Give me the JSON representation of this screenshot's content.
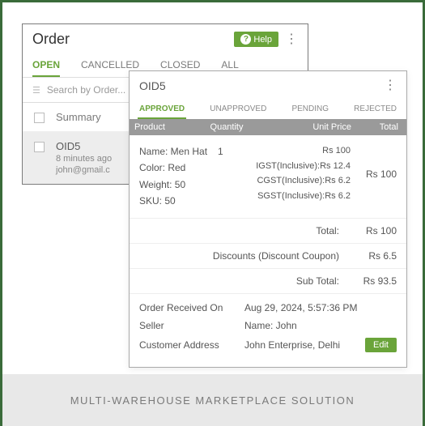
{
  "footer": "MULTI-WAREHOUSE MARKETPLACE SOLUTION",
  "panel1": {
    "title": "Order",
    "help": "Help",
    "tabs": [
      "OPEN",
      "CANCELLED",
      "CLOSED",
      "ALL"
    ],
    "search_placeholder": "Search by Order...",
    "summary_label": "Summary",
    "item": {
      "id": "OID5",
      "time": "8 minutes ago",
      "email": "john@gmail.c"
    }
  },
  "panel2": {
    "title": "OID5",
    "tabs": [
      "APPROVED",
      "UNAPPROVED",
      "PENDING",
      "REJECTED"
    ],
    "cols": {
      "product": "Product",
      "qty": "Quantity",
      "unit": "Unit Price",
      "total": "Total"
    },
    "product": {
      "name": "Name: Men Hat",
      "color": "Color: Red",
      "weight": "Weight: 50",
      "sku": "SKU: 50",
      "qty": "1",
      "unit_price": "Rs 100",
      "igst": "IGST(Inclusive):Rs 12.4",
      "cgst": "CGST(Inclusive):Rs 6.2",
      "sgst": "SGST(Inclusive):Rs 6.2",
      "row_total": "Rs 100"
    },
    "totals": {
      "total_label": "Total:",
      "total_val": "Rs 100",
      "discount_label": "Discounts (Discount Coupon)",
      "discount_val": "Rs 6.5",
      "subtotal_label": "Sub Total:",
      "subtotal_val": "Rs 93.5"
    },
    "info": {
      "received_k": "Order Received On",
      "received_v": "Aug 29, 2024, 5:57:36 PM",
      "seller_k": "Seller",
      "seller_v": "Name: John",
      "addr_k": "Customer Address",
      "addr_v": "John Enterprise, Delhi",
      "edit": "Edit"
    }
  }
}
